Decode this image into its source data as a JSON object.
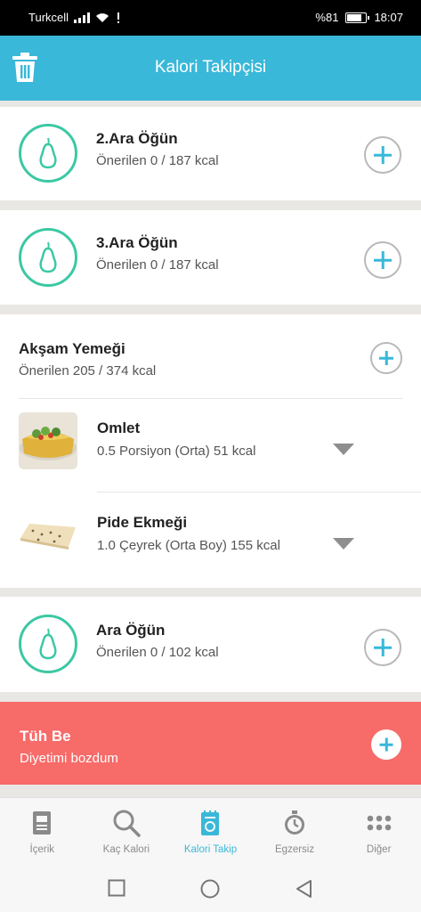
{
  "status": {
    "carrier": "Turkcell",
    "battery": "%81",
    "time": "18:07"
  },
  "header": {
    "title": "Kalori Takipçisi",
    "trash_icon": "trash-icon"
  },
  "meals": [
    {
      "title": "2.Ara Öğün",
      "subtitle": "Önerilen 0 / 187 kcal",
      "icon": "pear-icon"
    },
    {
      "title": "3.Ara Öğün",
      "subtitle": "Önerilen 0 / 187 kcal",
      "icon": "pear-icon"
    }
  ],
  "dinner": {
    "title": "Akşam Yemeği",
    "subtitle": "Önerilen 205 / 374 kcal",
    "foods": [
      {
        "name": "Omlet",
        "detail": "0.5 Porsiyon (Orta) 51 kcal",
        "image": "omelette-photo"
      },
      {
        "name": "Pide Ekmeği",
        "detail": "1.0 Çeyrek (Orta Boy) 155 kcal",
        "image": "pita-bread-photo"
      }
    ]
  },
  "snack": {
    "title": "Ara Öğün",
    "subtitle": "Önerilen 0 / 102 kcal",
    "icon": "pear-icon"
  },
  "alert": {
    "title": "Tüh Be",
    "subtitle": "Diyetimi bozdum"
  },
  "nav": [
    {
      "label": "İçerik",
      "icon": "content-icon"
    },
    {
      "label": "Kaç Kalori",
      "icon": "search-icon"
    },
    {
      "label": "Kalori Takip",
      "icon": "calorie-tracker-icon",
      "active": true
    },
    {
      "label": "Egzersiz",
      "icon": "stopwatch-icon"
    },
    {
      "label": "Diğer",
      "icon": "more-icon"
    }
  ],
  "colors": {
    "accent": "#39b8d9",
    "green": "#3cc8a4",
    "alert": "#f76b69"
  }
}
